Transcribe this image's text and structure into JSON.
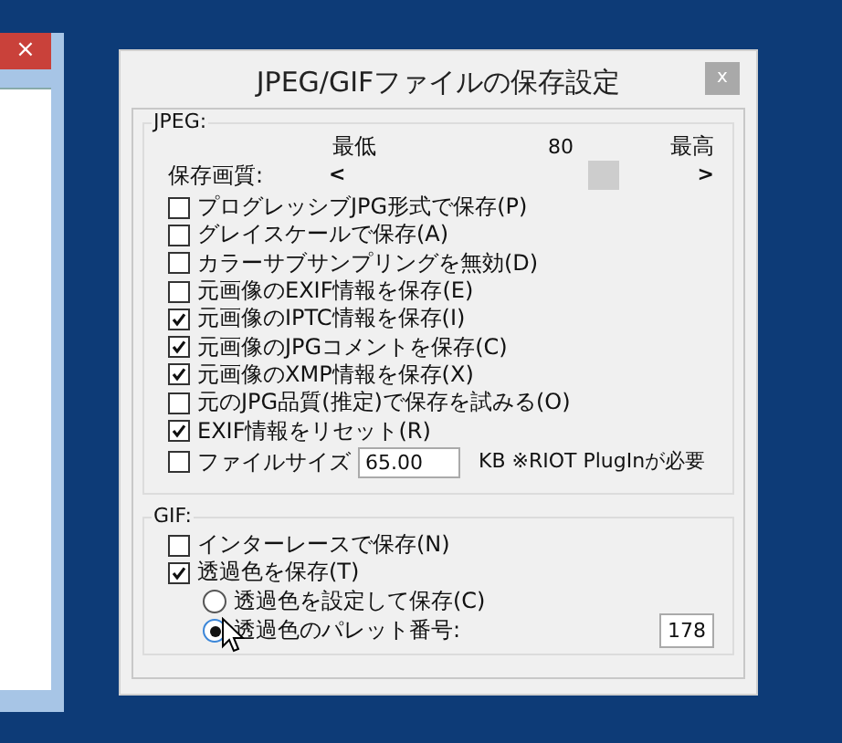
{
  "background_window": {
    "close_label": "×"
  },
  "dialog": {
    "title": "JPEG/GIFファイルの保存設定",
    "close_label": "x"
  },
  "jpeg": {
    "label": "JPEG:",
    "quality_label": "保存画質:",
    "min_label": "最低",
    "value_label": "80",
    "max_label": "最高",
    "left_arrow": "<",
    "right_arrow": ">",
    "level": 0.74,
    "options": [
      {
        "kind": "checkbox",
        "label": "プログレッシブJPG形式で保存(P)",
        "checked": false
      },
      {
        "kind": "checkbox",
        "label": "グレイスケールで保存(A)",
        "checked": false
      },
      {
        "kind": "checkbox",
        "label": "カラーサブサンプリングを無効(D)",
        "checked": false
      },
      {
        "kind": "checkbox",
        "label": "元画像のEXIF情報を保存(E)",
        "checked": false
      },
      {
        "kind": "checkbox",
        "label": "元画像のIPTC情報を保存(I)",
        "checked": true
      },
      {
        "kind": "checkbox",
        "label": "元画像のJPGコメントを保存(C)",
        "checked": true
      },
      {
        "kind": "checkbox",
        "label": "元画像のXMP情報を保存(X)",
        "checked": true
      },
      {
        "kind": "checkbox",
        "label": "元のJPG品質(推定)で保存を試みる(O)",
        "checked": false
      },
      {
        "kind": "checkbox",
        "label": "EXIF情報をリセット(R)",
        "checked": true
      },
      {
        "kind": "filesize",
        "label": "ファイルサイズ",
        "checked": false,
        "value": "65.00",
        "suffix": "KB ※RIOT PlugInが必要"
      }
    ]
  },
  "gif": {
    "label": "GIF:",
    "options": [
      {
        "label": "インターレースで保存(N)",
        "checked": false
      },
      {
        "label": "透過色を保存(T)",
        "checked": true
      }
    ],
    "radios": [
      {
        "label": "透過色を設定して保存(C)",
        "selected": false
      },
      {
        "label": "透過色のパレット番号:",
        "selected": true,
        "value": "178"
      }
    ]
  }
}
